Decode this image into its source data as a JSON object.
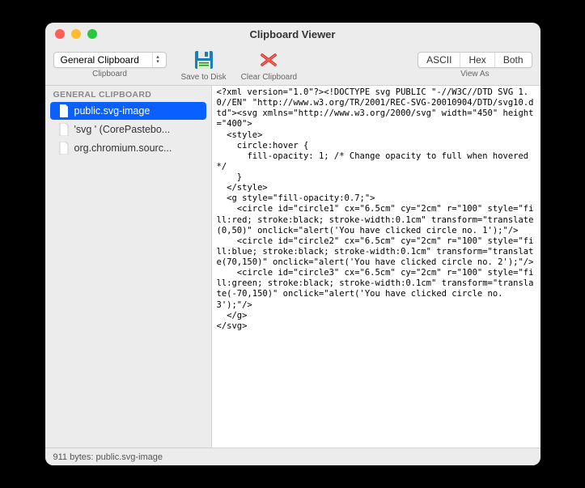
{
  "window": {
    "title": "Clipboard Viewer"
  },
  "toolbar": {
    "clipboard_selector": {
      "label": "Clipboard",
      "value": "General Clipboard"
    },
    "save": {
      "label": "Save to Disk"
    },
    "clear": {
      "label": "Clear Clipboard"
    },
    "view_as": {
      "label": "View As",
      "options": [
        "ASCII",
        "Hex",
        "Both"
      ]
    }
  },
  "sidebar": {
    "header": "GENERAL CLIPBOARD",
    "items": [
      {
        "label": "public.svg-image",
        "selected": true
      },
      {
        "label": "'svg ' (CorePastebo...",
        "selected": false
      },
      {
        "label": "org.chromium.sourc...",
        "selected": false
      }
    ]
  },
  "content": "<?xml version=\"1.0\"?><!DOCTYPE svg PUBLIC \"-//W3C//DTD SVG 1.0//EN\" \"http://www.w3.org/TR/2001/REC-SVG-20010904/DTD/svg10.dtd\"><svg xmlns=\"http://www.w3.org/2000/svg\" width=\"450\" height=\"400\">\n  <style>\n    circle:hover {\n      fill-opacity: 1; /* Change opacity to full when hovered */\n    }\n  </style>\n  <g style=\"fill-opacity:0.7;\">\n    <circle id=\"circle1\" cx=\"6.5cm\" cy=\"2cm\" r=\"100\" style=\"fill:red; stroke:black; stroke-width:0.1cm\" transform=\"translate(0,50)\" onclick=\"alert('You have clicked circle no. 1');\"/>\n    <circle id=\"circle2\" cx=\"6.5cm\" cy=\"2cm\" r=\"100\" style=\"fill:blue; stroke:black; stroke-width:0.1cm\" transform=\"translate(70,150)\" onclick=\"alert('You have clicked circle no. 2');\"/>\n    <circle id=\"circle3\" cx=\"6.5cm\" cy=\"2cm\" r=\"100\" style=\"fill:green; stroke:black; stroke-width:0.1cm\" transform=\"translate(-70,150)\" onclick=\"alert('You have clicked circle no. 3');\"/>\n  </g>\n</svg>",
  "statusbar": {
    "text": "911 bytes: public.svg-image"
  }
}
